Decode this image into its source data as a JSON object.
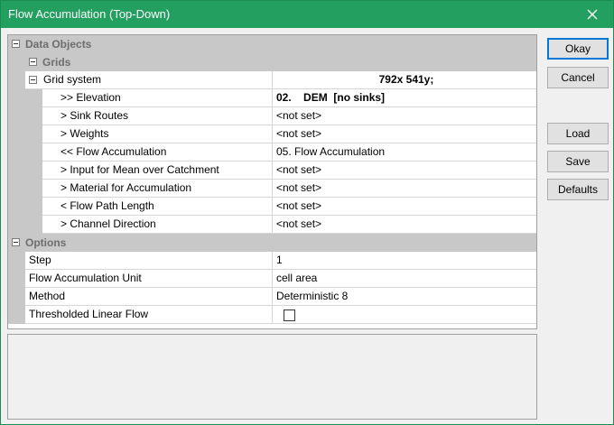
{
  "window": {
    "title": "Flow Accumulation (Top-Down)"
  },
  "buttons": {
    "okay": "Okay",
    "cancel": "Cancel",
    "load": "Load",
    "save": "Save",
    "defaults": "Defaults"
  },
  "categories": {
    "data_objects": "Data Objects",
    "grids": "Grids",
    "options": "Options"
  },
  "grid_system": {
    "label": "Grid system",
    "value": "792x 541y;"
  },
  "parameters": [
    {
      "label": ">> Elevation",
      "value_num": "02.",
      "value_name": "DEM",
      "value_suffix": "[no sinks]"
    },
    {
      "label": "> Sink Routes",
      "value": "<not set>"
    },
    {
      "label": "> Weights",
      "value": "<not set>"
    },
    {
      "label": "<< Flow Accumulation",
      "value": "05. Flow Accumulation"
    },
    {
      "label": "> Input for Mean over Catchment",
      "value": "<not set>"
    },
    {
      "label": "> Material for Accumulation",
      "value": "<not set>"
    },
    {
      "label": "< Flow Path Length",
      "value": "<not set>"
    },
    {
      "label": "> Channel Direction",
      "value": "<not set>"
    }
  ],
  "options": [
    {
      "label": "Step",
      "value": "1"
    },
    {
      "label": "Flow Accumulation Unit",
      "value": "cell area"
    },
    {
      "label": "Method",
      "value": "Deterministic 8"
    },
    {
      "label": "Thresholded Linear Flow",
      "checked": false
    }
  ]
}
